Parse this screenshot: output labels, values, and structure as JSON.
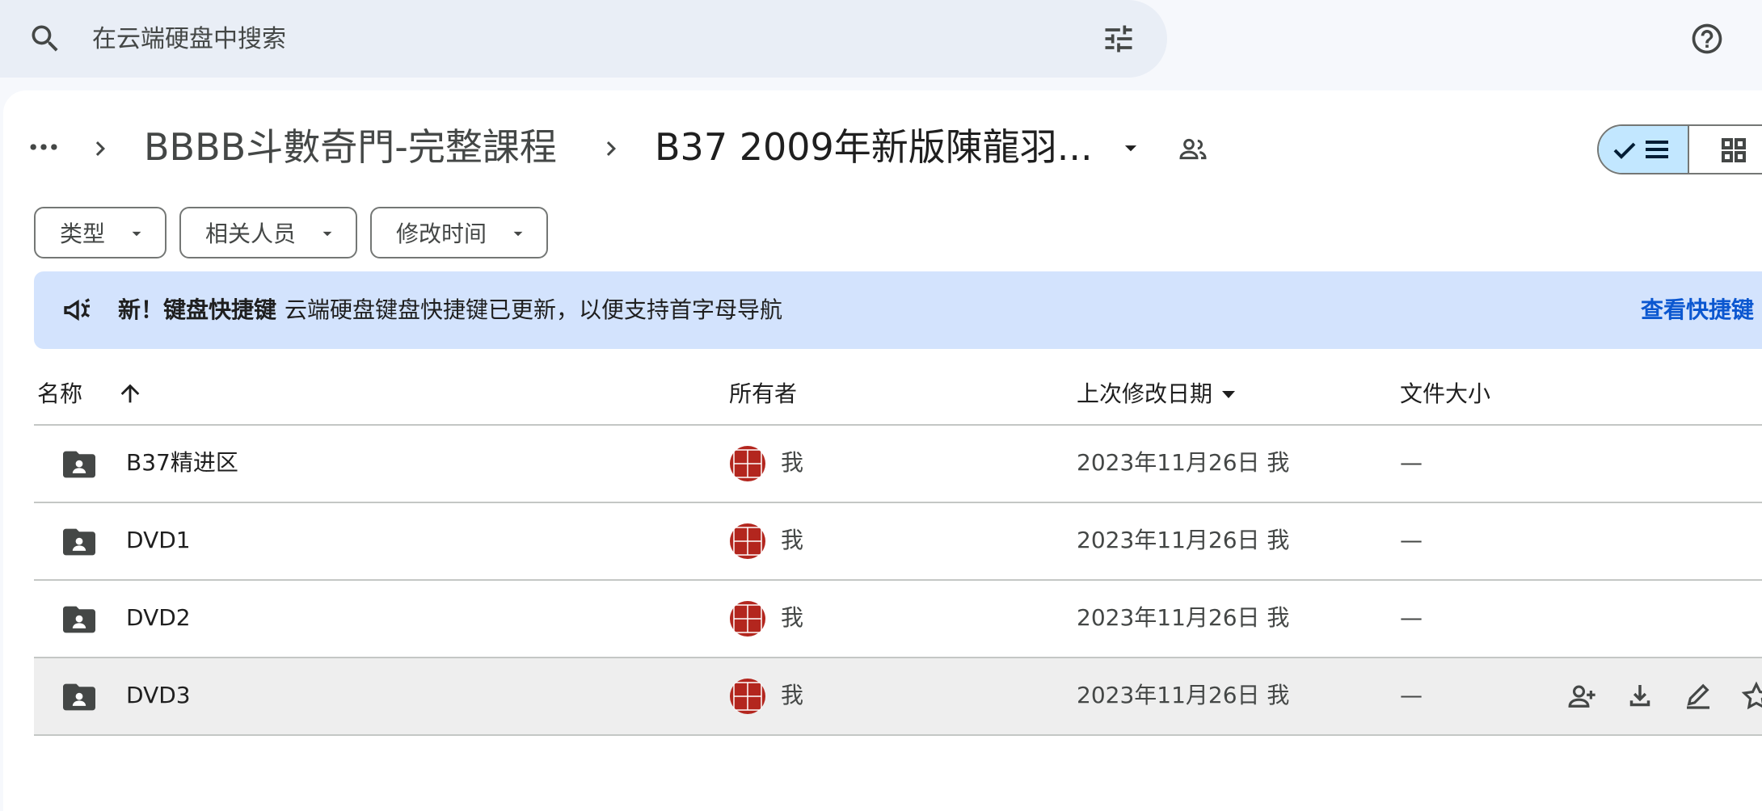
{
  "search": {
    "placeholder": "在云端硬盘中搜索"
  },
  "breadcrumb": {
    "parent": "BBBB斗數奇門-完整課程",
    "current": "B37 2009年新版陳龍羽..."
  },
  "filters": [
    {
      "label": "类型"
    },
    {
      "label": "相关人员"
    },
    {
      "label": "修改时间"
    }
  ],
  "banner": {
    "bold": "新！键盘快捷键",
    "text": "云端硬盘键盘快捷键已更新，以便支持首字母导航",
    "link": "查看快捷键"
  },
  "table": {
    "headers": {
      "name": "名称",
      "owner": "所有者",
      "modified": "上次修改日期",
      "size": "文件大小"
    },
    "rows": [
      {
        "name": "B37精进区",
        "owner": "我",
        "modified": "2023年11月26日 我",
        "size": "—"
      },
      {
        "name": "DVD1",
        "owner": "我",
        "modified": "2023年11月26日 我",
        "size": "—"
      },
      {
        "name": "DVD2",
        "owner": "我",
        "modified": "2023年11月26日 我",
        "size": "—"
      },
      {
        "name": "DVD3",
        "owner": "我",
        "modified": "2023年11月26日 我",
        "size": "—"
      }
    ]
  },
  "icons": {
    "search": "search-icon",
    "tune": "tune-icon",
    "help": "help-icon",
    "folder": "shared-folder-icon",
    "view_list": "list-view-icon",
    "view_grid": "grid-view-icon",
    "share": "shared-people-icon",
    "announce": "megaphone-icon"
  },
  "colors": {
    "background": "#f6f8fc",
    "search_bg": "#e9eef6",
    "banner_bg": "#d3e3fd",
    "link": "#0b57d0",
    "selected_toggle": "#c2e7ff",
    "avatar_red": "#b3261e"
  }
}
